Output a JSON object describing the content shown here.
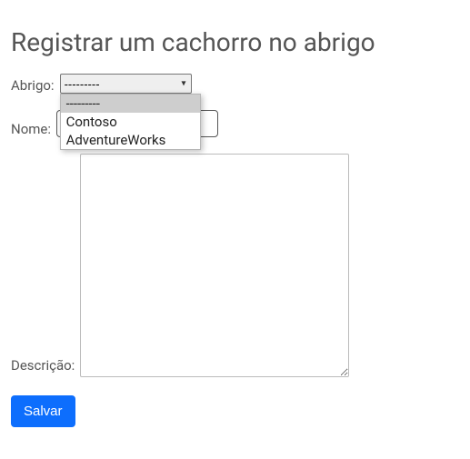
{
  "title": "Registrar um cachorro no abrigo",
  "labels": {
    "abrigo": "Abrigo:",
    "nome": "Nome:",
    "descricao": "Descrição:"
  },
  "abrigo_select": {
    "selected": "---------",
    "options": [
      "---------",
      "Contoso",
      "AdventureWorks"
    ],
    "highlighted_index": 0
  },
  "nome_value": "",
  "descricao_value": "",
  "save_button": "Salvar"
}
